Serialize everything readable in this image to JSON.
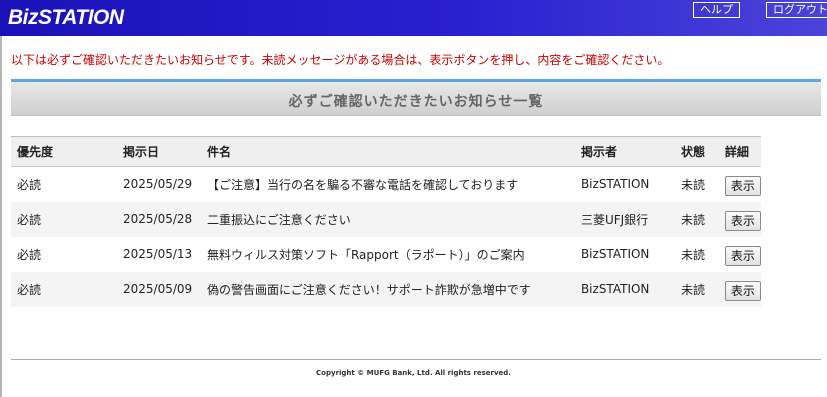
{
  "header": {
    "logo": "BizSTATION",
    "help_label": "ヘルプ",
    "logout_label": "ログアウト",
    "bg_color": "#1a12b8"
  },
  "notice": "以下は必ずご確認いただきたいお知らせです。未読メッセージがある場合は、表示ボタンを押し、内容をご確認ください。",
  "section": {
    "title": "必ずご確認いただきたいお知らせ一覧",
    "accent_color": "#5aa8e6"
  },
  "table": {
    "headers": {
      "priority": "優先度",
      "date": "掲示日",
      "title": "件名",
      "poster": "掲示者",
      "status": "状態",
      "detail": "詳細"
    },
    "rows": [
      {
        "priority": "必読",
        "date": "2025/05/29",
        "title": "【ご注意】当行の名を騙る不審な電話を確認しております",
        "poster": "BizSTATION",
        "status": "未読",
        "action": "表示"
      },
      {
        "priority": "必読",
        "date": "2025/05/28",
        "title": "二重振込にご注意ください",
        "poster": "三菱UFJ銀行",
        "status": "未読",
        "action": "表示"
      },
      {
        "priority": "必読",
        "date": "2025/05/13",
        "title": "無料ウィルス対策ソフト「Rapport（ラポート）」のご案内",
        "poster": "BizSTATION",
        "status": "未読",
        "action": "表示"
      },
      {
        "priority": "必読",
        "date": "2025/05/09",
        "title": "偽の警告画面にご注意ください！サポート詐欺が急増中です",
        "poster": "BizSTATION",
        "status": "未読",
        "action": "表示"
      }
    ]
  },
  "footer": {
    "copyright": "Copyright © MUFG Bank, Ltd. All rights reserved."
  }
}
